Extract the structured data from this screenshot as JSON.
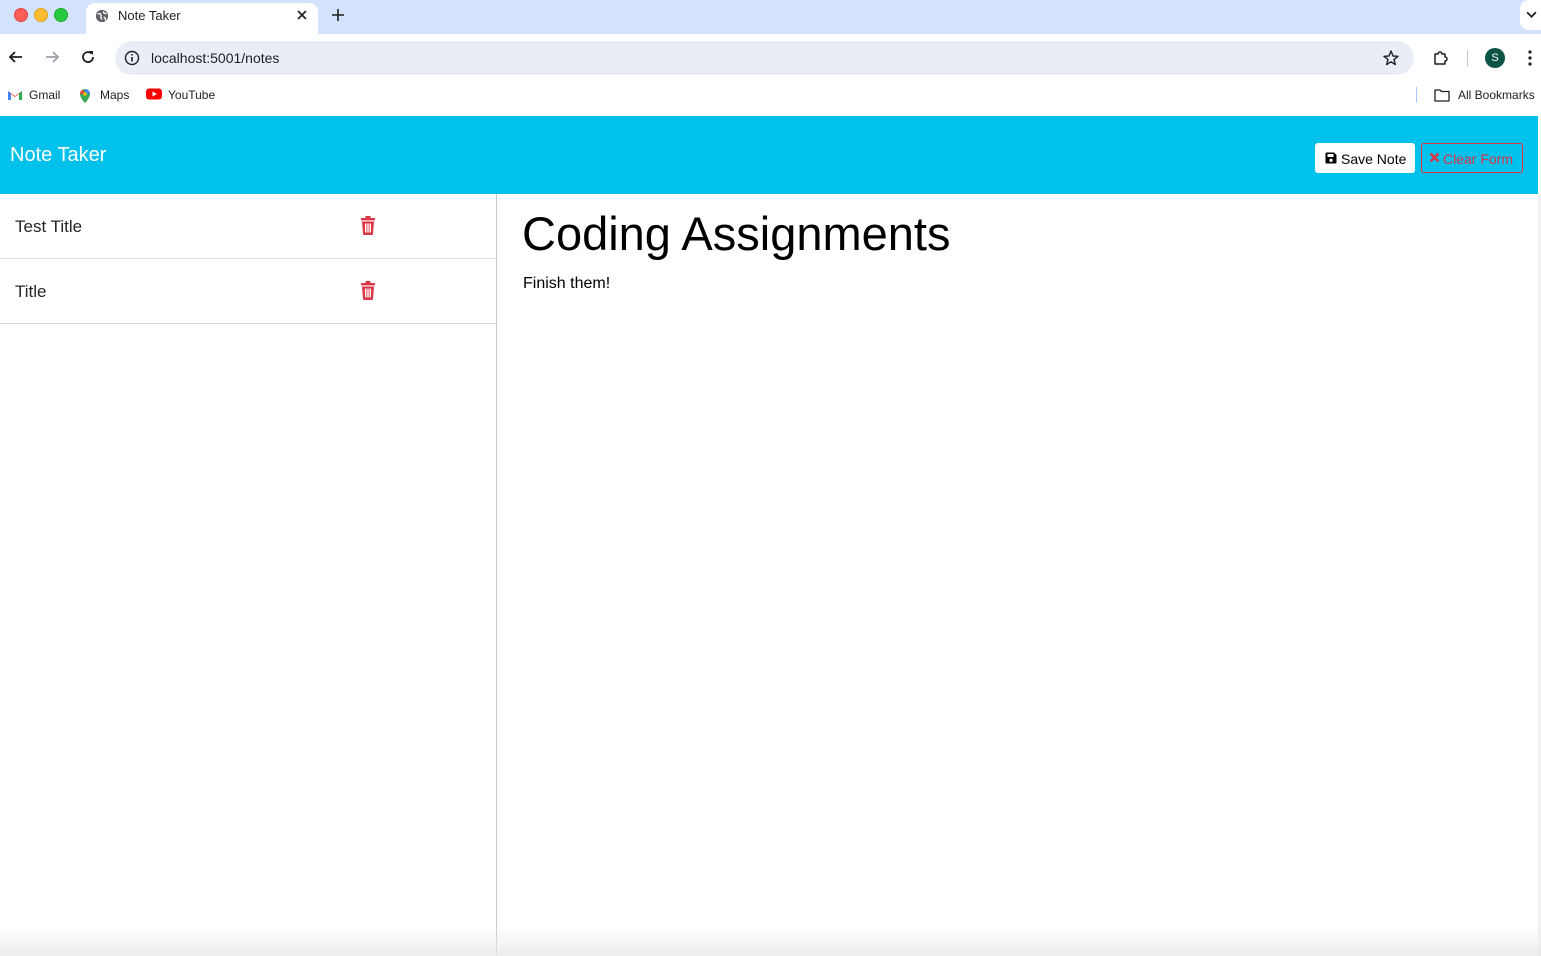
{
  "browser": {
    "tab": {
      "title": "Note Taker"
    },
    "address_bar": {
      "url": "localhost:5001/notes"
    },
    "profile": {
      "initial": "S"
    },
    "bookmarks": [
      {
        "label": "Gmail",
        "icon": "gmail-icon"
      },
      {
        "label": "Maps",
        "icon": "maps-icon"
      },
      {
        "label": "YouTube",
        "icon": "youtube-icon"
      }
    ],
    "all_bookmarks": {
      "label": "All Bookmarks",
      "icon": "folder-icon"
    }
  },
  "app": {
    "brand": "Note Taker",
    "actions": {
      "save_label": "Save Note",
      "save_icon": "save-icon",
      "clear_label": "Clear Form",
      "clear_icon": "x-icon"
    },
    "notes": [
      {
        "title": "Test Title",
        "icon": "trash-icon"
      },
      {
        "title": "Title",
        "icon": "trash-icon"
      }
    ],
    "active_note": {
      "title": "Coding Assignments",
      "text": "Finish them!"
    },
    "colors": {
      "navbar": "#00c0ec",
      "danger": "#dc3545"
    }
  }
}
